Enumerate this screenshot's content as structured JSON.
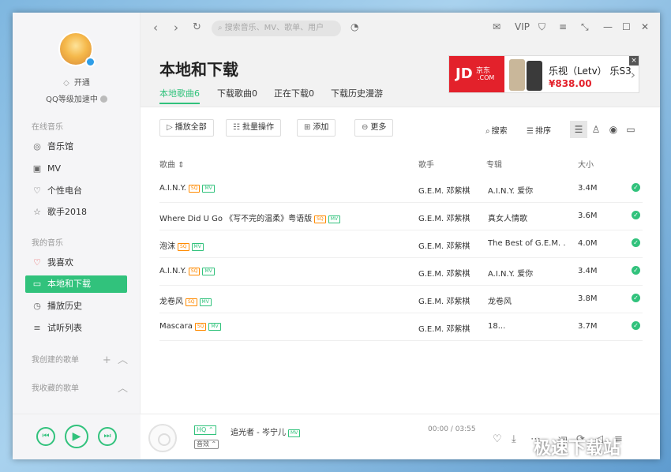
{
  "sidebar": {
    "vip_label": "开通",
    "level_label": "QQ等级加速中",
    "online_section": "在线音乐",
    "online_items": [
      {
        "label": "音乐馆",
        "icon": "music-hall-icon"
      },
      {
        "label": "MV",
        "icon": "video-icon"
      },
      {
        "label": "个性电台",
        "icon": "radio-icon"
      },
      {
        "label": "歌手2018",
        "icon": "star-icon"
      }
    ],
    "my_section": "我的音乐",
    "my_items": [
      {
        "label": "我喜欢",
        "icon": "heart-icon"
      },
      {
        "label": "本地和下载",
        "icon": "monitor-icon"
      },
      {
        "label": "播放历史",
        "icon": "clock-icon"
      },
      {
        "label": "试听列表",
        "icon": "playlist-icon"
      }
    ],
    "created_section": "我创建的歌单",
    "collected_section": "我收藏的歌单"
  },
  "topbar": {
    "search_placeholder": "搜索音乐、MV、歌单、用户",
    "vip": "VIP"
  },
  "header": {
    "title": "本地和下载",
    "tabs": [
      "本地歌曲6",
      "下载歌曲0",
      "正在下载0",
      "下载历史漫游"
    ],
    "active_tab": 0
  },
  "ad": {
    "brand_big": "JD",
    "brand_small": "京东",
    "brand_com": ".COM",
    "product": "乐视（Letv） 乐S3",
    "price": "¥838.00",
    "close": "×"
  },
  "toolbar": {
    "play_all": "播放全部",
    "batch": "批量操作",
    "add": "添加",
    "more": "更多",
    "search": "搜索",
    "sort": "排序"
  },
  "table": {
    "headers": {
      "song": "歌曲",
      "artist": "歌手",
      "album": "专辑",
      "size": "大小"
    },
    "rows": [
      {
        "title": "A.I.N.Y.",
        "artist": "G.E.M. 邓紫棋",
        "album": "A.I.N.Y. 爱你",
        "size": "3.4M"
      },
      {
        "title": "Where Did U Go 《写不完的温柔》粤语版",
        "artist": "G.E.M. 邓紫棋",
        "album": "真女人情歌",
        "size": "3.6M"
      },
      {
        "title": "泡沫",
        "artist": "G.E.M. 邓紫棋",
        "album": "The Best of G.E.M. ...",
        "size": "4.0M"
      },
      {
        "title": "A.I.N.Y.",
        "artist": "G.E.M. 邓紫棋",
        "album": "A.I.N.Y. 爱你",
        "size": "3.4M"
      },
      {
        "title": "龙卷风",
        "artist": "G.E.M. 邓紫棋",
        "album": "龙卷风",
        "size": "3.8M"
      },
      {
        "title": "Mascara",
        "artist": "G.E.M. 邓紫棋",
        "album": "18...",
        "size": "3.7M"
      }
    ],
    "tag_sq": "SQ",
    "tag_mv": "MV"
  },
  "player": {
    "quality": "HQ",
    "effect": "音效",
    "now_playing": "追光者 - 岑宁儿",
    "time": "00:00 / 03:55"
  },
  "watermark": "极速下载站",
  "colors": {
    "accent": "#31c27c",
    "sq": "#ff8a00",
    "ad_red": "#e3212b"
  }
}
